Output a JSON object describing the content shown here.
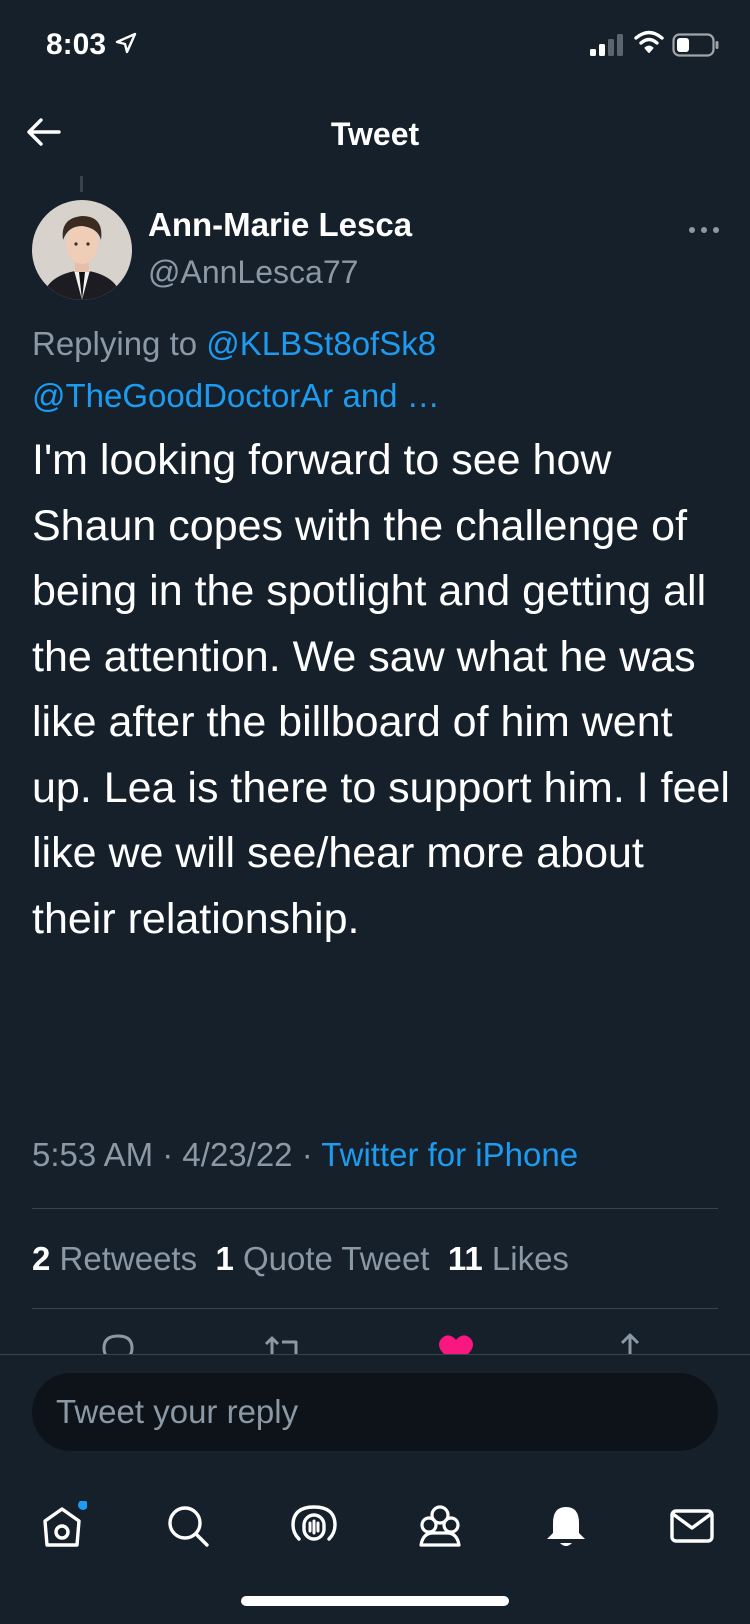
{
  "status_bar": {
    "time": "8:03",
    "icons": [
      "location-arrow-icon",
      "signal-icon",
      "wifi-icon",
      "battery-icon"
    ]
  },
  "header": {
    "title": "Tweet",
    "back_icon": "back-arrow-icon"
  },
  "tweet": {
    "author_name": "Ann-Marie Lesca",
    "author_handle": "@AnnLesca77",
    "replying_prefix": "Replying to",
    "replying_mention_1": "@KLBSt8ofSk8",
    "replying_mention_2": "@TheGoodDoctorAr",
    "replying_suffix": "and …",
    "text": "I'm looking forward to see how Shaun copes with the challenge of being in the spotlight and getting all the attention. We saw what he was like after the billboard of him went up. Lea is there to support him. I feel like we will see/hear more about their relationship.",
    "time": "5:53 AM",
    "date": "4/23/22",
    "separator": "·",
    "source": "Twitter for iPhone",
    "stats": {
      "retweets_count": "2",
      "retweets_label": "Retweets",
      "quotes_count": "1",
      "quotes_label": "Quote Tweet",
      "likes_count": "11",
      "likes_label": "Likes"
    }
  },
  "reply": {
    "placeholder": "Tweet your reply"
  },
  "tab_bar": {
    "tabs": [
      "home-icon",
      "search-icon",
      "spaces-icon",
      "communities-icon",
      "notifications-icon",
      "messages-icon"
    ]
  },
  "colors": {
    "background": "#15202b",
    "link": "#1d9bf0",
    "secondary_text": "#8b98a5",
    "like": "#f91880"
  }
}
